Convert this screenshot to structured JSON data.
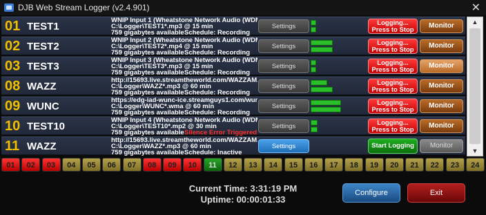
{
  "window": {
    "title": "DJB Web Stream Logger (v2.4.901)",
    "close_label": "✕"
  },
  "rows": [
    {
      "num": "01",
      "name": "TEST1",
      "line1": "WNIP Input  1 (Wheatstone Network Audio (WDM)...",
      "line2": "C:\\Logger\\TEST1*.mp3 @ 15 min",
      "line3": "759 gigabytes available",
      "schedule": "Schedule: Recording",
      "settings": "Settings",
      "log": "Logging... Press to Stop",
      "monitor": "Monitor"
    },
    {
      "num": "02",
      "name": "TEST2",
      "line1": "WNIP Input  2 (Wheatstone Network Audio (WDM)...",
      "line2": "C:\\Logger\\TEST2*.mp4 @ 15 min",
      "line3": "759 gigabytes available",
      "schedule": "Schedule: Recording",
      "settings": "Settings",
      "log": "Logging... Press to Stop",
      "monitor": "Monitor"
    },
    {
      "num": "03",
      "name": "TEST3",
      "line1": "WNIP Input  3 (Wheatstone Network Audio (WDM)...",
      "line2": "C:\\Logger\\TEST3*.mp3 @ 15 min",
      "line3": "759 gigabytes available",
      "schedule": "Schedule: Recording",
      "settings": "Settings",
      "log": "Logging... Press to Stop",
      "monitor": "Monitor"
    },
    {
      "num": "08",
      "name": "WAZZ",
      "line1": "http://15693.live.streamtheworld.com/WAZZAMAA...",
      "line2": "C:\\Logger\\WAZZ*.mp3 @ 60 min",
      "line3": "759 gigabytes available",
      "schedule": "Schedule: Recording",
      "settings": "Settings",
      "log": "Logging... Press to Stop",
      "monitor": "Monitor"
    },
    {
      "num": "09",
      "name": "WUNC",
      "line1": "https://edg-iad-wunc-ice.streamguys1.com/wunc-...",
      "line2": "C:\\Logger\\WUNC*.wma @ 60 min",
      "line3": "759 gigabytes available",
      "schedule": "Schedule: Recording",
      "settings": "Settings",
      "log": "Logging... Press to Stop",
      "monitor": "Monitor"
    },
    {
      "num": "10",
      "name": "TEST10",
      "line1": "WNIP Input  4 (Wheatstone Network Audio (WDM)...",
      "line2": "C:\\Logger\\TEST10*.mp2 @ 30 min",
      "line3": "759 gigabytes available",
      "error": "Silence Error Triggered",
      "settings": "Settings",
      "log": "Logging... Press to Stop",
      "monitor": "Monitor"
    },
    {
      "num": "11",
      "name": "WAZZ",
      "line1": "http://15693.live.streamtheworld.com/WAZZAMAA...",
      "line2": "C:\\Logger\\WAZZ*.mp3 @ 60 min",
      "line3": "759 gigabytes available",
      "schedule": "Schedule: Inactive",
      "settings": "Settings",
      "log": "Start Logging",
      "monitor": "Monitor"
    }
  ],
  "meter_levels": [
    [
      0.1,
      0.1
    ],
    [
      0.4,
      0.4
    ],
    [
      0.1,
      0.1
    ],
    [
      0.3,
      0.4
    ],
    [
      0.55,
      0.55
    ],
    [
      0.12,
      0.12
    ],
    [
      0,
      0
    ]
  ],
  "tabs": [
    {
      "label": "01",
      "state": "red"
    },
    {
      "label": "02",
      "state": "red"
    },
    {
      "label": "03",
      "state": "red"
    },
    {
      "label": "04",
      "state": "yellow"
    },
    {
      "label": "05",
      "state": "yellow"
    },
    {
      "label": "06",
      "state": "yellow"
    },
    {
      "label": "07",
      "state": "yellow"
    },
    {
      "label": "08",
      "state": "red"
    },
    {
      "label": "09",
      "state": "red"
    },
    {
      "label": "10",
      "state": "red"
    },
    {
      "label": "11",
      "state": "green"
    },
    {
      "label": "12",
      "state": "yellow"
    },
    {
      "label": "13",
      "state": "yellow"
    },
    {
      "label": "14",
      "state": "yellow"
    },
    {
      "label": "15",
      "state": "yellow"
    },
    {
      "label": "16",
      "state": "yellow"
    },
    {
      "label": "17",
      "state": "yellow"
    },
    {
      "label": "18",
      "state": "yellow"
    },
    {
      "label": "19",
      "state": "yellow"
    },
    {
      "label": "20",
      "state": "yellow"
    },
    {
      "label": "21",
      "state": "yellow"
    },
    {
      "label": "22",
      "state": "yellow"
    },
    {
      "label": "23",
      "state": "yellow"
    },
    {
      "label": "24",
      "state": "yellow"
    }
  ],
  "footer": {
    "current_time": "Current Time: 3:31:19 PM",
    "uptime": "Uptime: 00:00:01:33",
    "configure_label": "Configure",
    "exit_label": "Exit"
  },
  "colors": {
    "red": "#e00000",
    "yellow": "#a89640",
    "green": "#1f9a1f",
    "number": "#f0c000",
    "accent": "#3d86c8"
  },
  "scrollbar": {
    "up": "▲",
    "down": "▼"
  }
}
